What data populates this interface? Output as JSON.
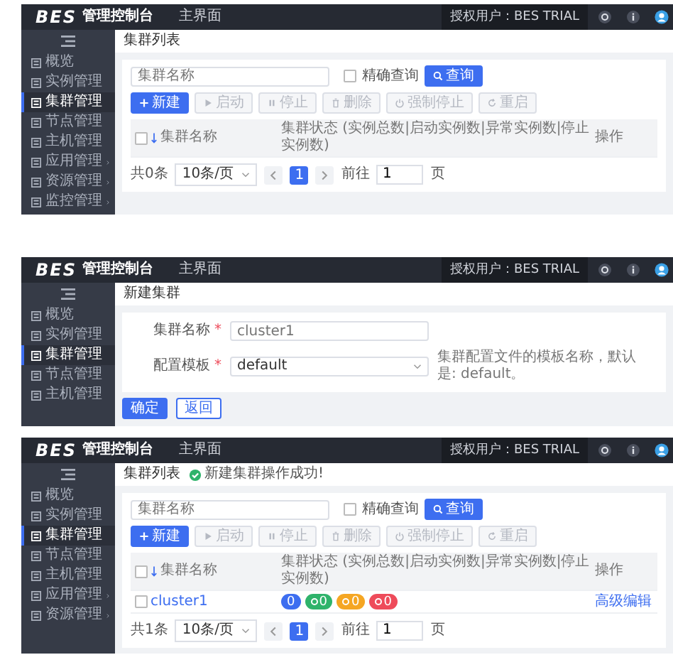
{
  "screens": [
    {
      "kind": "list",
      "header": {
        "logo": "BES",
        "title": "管理控制台",
        "tab": "主界面",
        "user": "授权用户：BES TRIAL"
      },
      "sidebar": [
        {
          "label": "概览",
          "selected": false,
          "expandable": false
        },
        {
          "label": "实例管理",
          "selected": false,
          "expandable": false
        },
        {
          "label": "集群管理",
          "selected": true,
          "expandable": false
        },
        {
          "label": "节点管理",
          "selected": false,
          "expandable": false
        },
        {
          "label": "主机管理",
          "selected": false,
          "expandable": false
        },
        {
          "label": "应用管理",
          "selected": false,
          "expandable": true
        },
        {
          "label": "资源管理",
          "selected": false,
          "expandable": true
        },
        {
          "label": "监控管理",
          "selected": false,
          "expandable": true
        }
      ],
      "page_title": "集群列表",
      "search": {
        "placeholder": "集群名称"
      },
      "exact": {
        "label": "精确查询",
        "checked": false
      },
      "query_button": "查询",
      "toolbar": [
        {
          "label": "新建",
          "disabled": false
        },
        {
          "label": "启动",
          "disabled": true
        },
        {
          "label": "停止",
          "disabled": true
        },
        {
          "label": "删除",
          "disabled": true
        },
        {
          "label": "强制停止",
          "disabled": true
        },
        {
          "label": "重启",
          "disabled": true
        }
      ],
      "table": {
        "all_checked": false,
        "columns": [
          "集群名称",
          "集群状态 (实例总数|启动实例数|异常实例数|停止实例数)",
          "操作"
        ]
      },
      "pagination": {
        "total": "共0条",
        "page_size": "10条/页",
        "pages": [
          {
            "label": "1",
            "selected": true
          }
        ],
        "goto": "前往",
        "goto_value": "1",
        "suffix": "页"
      }
    },
    {
      "kind": "form",
      "header": {
        "logo": "BES",
        "title": "管理控制台",
        "tab": "主界面",
        "user": "授权用户：BES TRIAL"
      },
      "sidebar": [
        {
          "label": "概览",
          "selected": false,
          "expandable": false
        },
        {
          "label": "实例管理",
          "selected": false,
          "expandable": false
        },
        {
          "label": "集群管理",
          "selected": true,
          "expandable": false
        },
        {
          "label": "节点管理",
          "selected": false,
          "expandable": false
        },
        {
          "label": "主机管理",
          "selected": false,
          "expandable": false
        }
      ],
      "page_title": "新建集群",
      "fields": [
        {
          "kind": "text",
          "label": "集群名称",
          "mark": "*",
          "placeholder": "cluster1"
        },
        {
          "kind": "select",
          "label": "配置模板",
          "mark": "*",
          "value": "default",
          "hint": "集群配置文件的模板名称，默认是: default。"
        }
      ],
      "buttons": [
        {
          "label": "确定",
          "primary": true
        },
        {
          "label": "返回",
          "primary": false
        }
      ]
    },
    {
      "kind": "list",
      "header": {
        "logo": "BES",
        "title": "管理控制台",
        "tab": "主界面",
        "user": "授权用户：BES TRIAL"
      },
      "sidebar": [
        {
          "label": "概览",
          "selected": false,
          "expandable": false
        },
        {
          "label": "实例管理",
          "selected": false,
          "expandable": false
        },
        {
          "label": "集群管理",
          "selected": true,
          "expandable": false
        },
        {
          "label": "节点管理",
          "selected": false,
          "expandable": false
        },
        {
          "label": "主机管理",
          "selected": false,
          "expandable": false
        },
        {
          "label": "应用管理",
          "selected": false,
          "expandable": true
        },
        {
          "label": "资源管理",
          "selected": false,
          "expandable": true
        }
      ],
      "page_title": "集群列表",
      "notice": "新建集群操作成功!",
      "search": {
        "placeholder": "集群名称"
      },
      "exact": {
        "label": "精确查询",
        "checked": false
      },
      "query_button": "查询",
      "toolbar": [
        {
          "label": "新建",
          "disabled": false
        },
        {
          "label": "启动",
          "disabled": true
        },
        {
          "label": "停止",
          "disabled": true
        },
        {
          "label": "删除",
          "disabled": true
        },
        {
          "label": "强制停止",
          "disabled": true
        },
        {
          "label": "重启",
          "disabled": true
        }
      ],
      "table": {
        "all_checked": false,
        "columns": [
          "集群名称",
          "集群状态 (实例总数|启动实例数|异常实例数|停止实例数)",
          "操作"
        ],
        "rows": [
          {
            "checked": false,
            "name": "cluster1",
            "counts": [
              {
                "value": "0",
                "color": "#3d6ef0"
              },
              {
                "value": "0",
                "color": "#2fb36b"
              },
              {
                "value": "0",
                "color": "#f5a623"
              },
              {
                "value": "0",
                "color": "#ee4b5a"
              }
            ],
            "action": "高级编辑"
          }
        ]
      },
      "pagination": {
        "total": "共1条",
        "page_size": "10条/页",
        "pages": [
          {
            "label": "1",
            "selected": true
          }
        ],
        "goto": "前往",
        "goto_value": "1",
        "suffix": "页"
      }
    }
  ]
}
